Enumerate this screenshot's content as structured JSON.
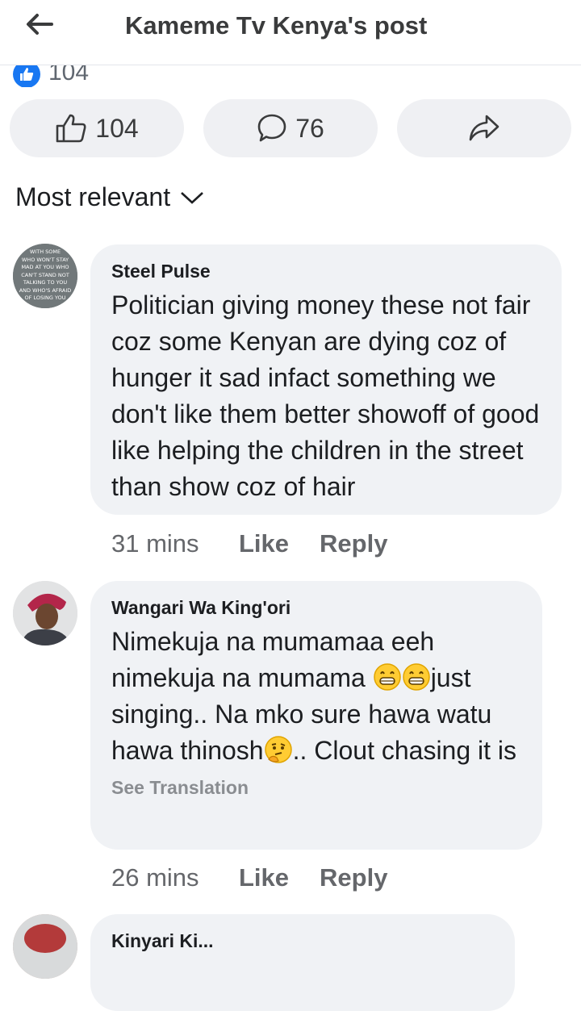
{
  "header": {
    "title": "Kameme Tv Kenya's post",
    "back_icon": "back-arrow-icon"
  },
  "reactions": {
    "count": "104",
    "icon": "like-badge-icon"
  },
  "actions": {
    "like_count": "104",
    "comment_count": "76",
    "share_icon": "share-icon"
  },
  "sort": {
    "label": "Most relevant",
    "icon": "chevron-down-icon"
  },
  "comments": [
    {
      "author": "Steel Pulse",
      "text": "Politician giving money these not fair coz some Kenyan are dying coz of hunger it sad infact something we don't like them better showoff of good like helping the children in the street than show coz of hair",
      "time": "31 mins",
      "like_label": "Like",
      "reply_label": "Reply",
      "avatar_lines": [
        "WITH SOME",
        "WHO WON'T STAY",
        "MAD AT YOU WHO",
        "CAN'T STAND NOT",
        "TALKING TO YOU",
        "AND WHO'S AFRAID",
        "OF LOSING YOU"
      ]
    },
    {
      "author": "Wangari Wa King'ori",
      "text_part1": "Nimekuja na mumamaa eeh nimekuja na mumama ",
      "text_part2": "just singing.. Na mko sure hawa watu hawa thinosh",
      "text_part3": ".. Clout chasing it is",
      "see_translation": "See Translation",
      "time": "26 mins",
      "like_label": "Like",
      "reply_label": "Reply"
    },
    {
      "author": "Kinyari Ki..."
    }
  ],
  "colors": {
    "accent": "#1877f2",
    "bubble": "#f0f2f5",
    "muted": "#65676b"
  }
}
